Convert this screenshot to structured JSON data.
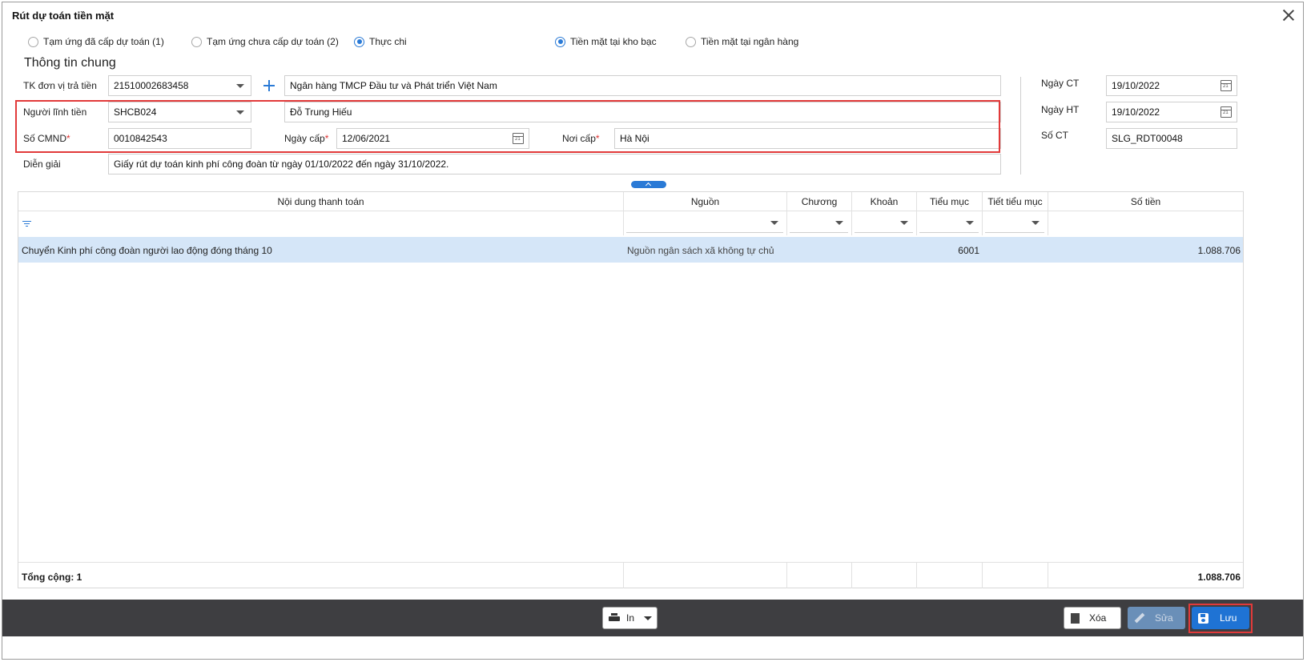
{
  "dialog": {
    "title": "Rút dự toán tiền mặt"
  },
  "options": {
    "type": [
      {
        "label": "Tạm ứng đã cấp dự toán (1)",
        "checked": false
      },
      {
        "label": "Tạm ứng chưa cấp dự toán (2)",
        "checked": false
      },
      {
        "label": "Thực chi",
        "checked": true
      }
    ],
    "cash_source": [
      {
        "label": "Tiền mặt tại kho bạc",
        "checked": true
      },
      {
        "label": "Tiền mặt tại ngân hàng",
        "checked": false
      }
    ]
  },
  "general": {
    "section_title": "Thông tin chung",
    "account": {
      "label": "TK đơn vị trả tiền",
      "value": "21510002683458",
      "bank_name": "Ngân hàng TMCP Đầu tư và Phát triển Việt Nam"
    },
    "receiver": {
      "label": "Người lĩnh tiền",
      "value": "SHCB024",
      "name": "Đỗ Trung Hiếu"
    },
    "id_number": {
      "label": "Số CMND",
      "value": "0010842543"
    },
    "issue_date": {
      "label": "Ngày cấp",
      "value": "12/06/2021"
    },
    "issue_place": {
      "label": "Nơi cấp",
      "value": "Hà Nội"
    },
    "description": {
      "label": "Diễn giải",
      "value": "Giấy rút dự toán kinh phí công đoàn từ ngày 01/10/2022 đến ngày 31/10/2022."
    }
  },
  "voucher": {
    "date_ct": {
      "label": "Ngày CT",
      "value": "19/10/2022"
    },
    "date_ht": {
      "label": "Ngày HT",
      "value": "19/10/2022"
    },
    "number": {
      "label": "Số CT",
      "value": "SLG_RDT00048"
    }
  },
  "grid": {
    "columns": [
      "Nội dung thanh toán",
      "Nguồn",
      "Chương",
      "Khoản",
      "Tiểu mục",
      "Tiết tiểu mục",
      "Số tiền"
    ],
    "rows": [
      {
        "content": "Chuyển Kinh phí công đoàn người lao động đóng tháng 10",
        "source": "Nguồn ngân sách xã không tự chủ",
        "chapter": "",
        "item": "",
        "sub_item": "6001",
        "detail_sub_item": "",
        "amount": "1.088.706"
      }
    ],
    "footer": {
      "label": "Tổng cộng: 1",
      "total": "1.088.706"
    }
  },
  "toolbar": {
    "print_label": "In",
    "delete_label": "Xóa",
    "edit_label": "Sửa",
    "save_label": "Lưu"
  },
  "colors": {
    "accent": "#1f73d4",
    "highlight": "#e23a3a",
    "selected_row": "#d5e6f8",
    "footer_bg": "#3e3e41"
  }
}
